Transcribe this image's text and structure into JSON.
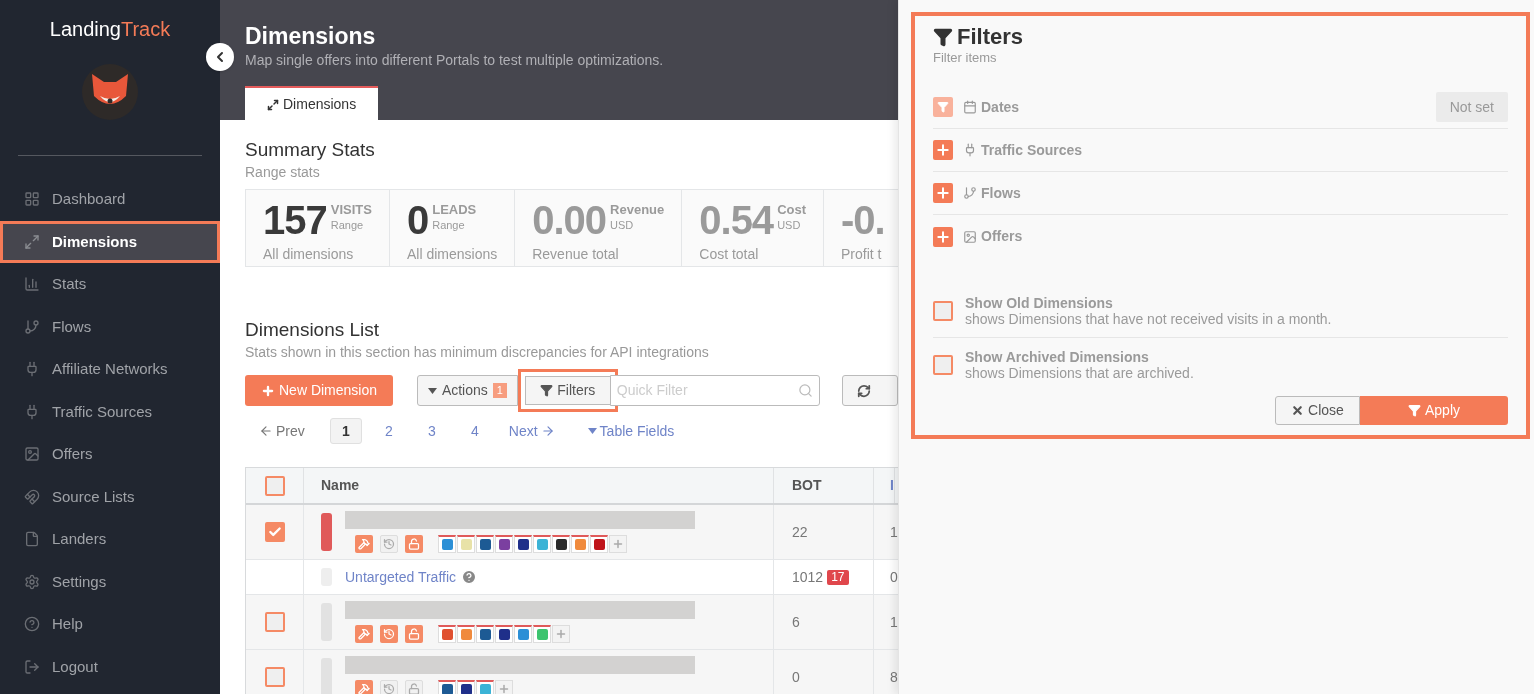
{
  "brand": {
    "part1": "Landing",
    "part2": "Track"
  },
  "sidebar": {
    "items": [
      {
        "label": "Dashboard",
        "selected": false,
        "highlighted": false
      },
      {
        "label": "Dimensions",
        "selected": true,
        "highlighted": true
      },
      {
        "label": "Stats",
        "selected": false,
        "highlighted": false
      },
      {
        "label": "Flows",
        "selected": false,
        "highlighted": false
      },
      {
        "label": "Affiliate Networks",
        "selected": false,
        "highlighted": false
      },
      {
        "label": "Traffic Sources",
        "selected": false,
        "highlighted": false
      },
      {
        "label": "Offers",
        "selected": false,
        "highlighted": false
      },
      {
        "label": "Source Lists",
        "selected": false,
        "highlighted": false
      },
      {
        "label": "Landers",
        "selected": false,
        "highlighted": false
      },
      {
        "label": "Settings",
        "selected": false,
        "highlighted": false
      },
      {
        "label": "Help",
        "selected": false,
        "highlighted": false
      },
      {
        "label": "Logout",
        "selected": false,
        "highlighted": false
      }
    ]
  },
  "header": {
    "title": "Dimensions",
    "subtitle": "Map single offers into different Portals to test multiple optimizations.",
    "tabs": [
      {
        "label": "Dimensions",
        "selected": true
      }
    ]
  },
  "summary": {
    "title": "Summary Stats",
    "subtitle": "Range stats",
    "cards": [
      {
        "value": "157",
        "unit": "VISITS",
        "sub": "Range",
        "caption": "All dimensions",
        "muted": false
      },
      {
        "value": "0",
        "unit": "LEADS",
        "sub": "Range",
        "caption": "All dimensions",
        "muted": false
      },
      {
        "value": "0.00",
        "unit": "Revenue",
        "sub": "USD",
        "caption": "Revenue total",
        "muted": true
      },
      {
        "value": "0.54",
        "unit": "Cost",
        "sub": "USD",
        "caption": "Cost total",
        "muted": true
      },
      {
        "value": "-0.",
        "caption": "Profit t",
        "muted": true
      }
    ]
  },
  "list": {
    "title": "Dimensions List",
    "subtitle": "Stats shown in this section has minimum discrepancies for API integrations",
    "toolbar": {
      "new_button": "New Dimension",
      "actions_button": "Actions",
      "actions_badge": "1",
      "filters_button": "Filters",
      "filters_highlighted": true,
      "quick_filter_placeholder": "Quick Filter"
    },
    "pagination": {
      "prev": "Prev",
      "pages": [
        {
          "label": "1",
          "selected": true
        },
        {
          "label": "2",
          "selected": false
        },
        {
          "label": "3",
          "selected": false
        },
        {
          "label": "4",
          "selected": false
        }
      ],
      "next": "Next",
      "table_fields": "Table Fields"
    },
    "table": {
      "header_checked": false,
      "columns": [
        "Name",
        "BOT",
        "I"
      ],
      "rows": [
        {
          "kind": "dimension",
          "checked": true,
          "color": "#e05a5a",
          "actions": [
            {
              "on": true
            },
            {
              "on": false
            },
            {
              "on": true
            }
          ],
          "sources": [
            {
              "color": "#2b8fd6"
            },
            {
              "color": "#e8e2a8"
            },
            {
              "color": "#1d5a94"
            },
            {
              "color": "#7b3fa0"
            },
            {
              "color": "#1f2f8a"
            },
            {
              "color": "#3bb3d6"
            },
            {
              "color": "#2a2a2a"
            },
            {
              "color": "#f08a3c"
            },
            {
              "color": "#c0141a"
            }
          ],
          "bot": "22",
          "column_3": "1"
        },
        {
          "kind": "untargeted",
          "name": "Untargeted Traffic",
          "color": "#eeeeee",
          "bot": "1012",
          "bot_badge": "17",
          "column_3": "0"
        },
        {
          "kind": "dimension",
          "checked": false,
          "color": "#e2e2e2",
          "actions": [
            {
              "on": true
            },
            {
              "on": true
            },
            {
              "on": true
            }
          ],
          "sources": [
            {
              "color": "#e05030"
            },
            {
              "color": "#f08a3c"
            },
            {
              "color": "#1d5a94"
            },
            {
              "color": "#1f2f8a"
            },
            {
              "color": "#2b8fd6"
            },
            {
              "color": "#3cc46e"
            }
          ],
          "bot": "6",
          "column_3": "1"
        },
        {
          "kind": "dimension",
          "checked": false,
          "color": "#e2e2e2",
          "actions": [
            {
              "on": true
            },
            {
              "on": false
            },
            {
              "on": false
            }
          ],
          "sources": [
            {
              "color": "#1d5a94"
            },
            {
              "color": "#1f2f8a"
            },
            {
              "color": "#3bb3d6"
            }
          ],
          "bot": "0",
          "column_3": "8"
        }
      ]
    }
  },
  "filters": {
    "highlighted": true,
    "title": "Filters",
    "subtitle": "Filter items",
    "items": [
      {
        "kind": "date",
        "label": "Dates",
        "value": "Not set"
      },
      {
        "kind": "add",
        "label": "Traffic Sources"
      },
      {
        "kind": "add",
        "label": "Flows"
      },
      {
        "kind": "add",
        "label": "Offers"
      }
    ],
    "options": [
      {
        "label": "Show Old Dimensions",
        "description": "shows Dimensions that have not received visits in a month.",
        "checked": false
      },
      {
        "label": "Show Archived Dimensions",
        "description": "shows Dimensions that are archived.",
        "checked": false
      }
    ],
    "close_button": "Close",
    "apply_button": "Apply"
  }
}
